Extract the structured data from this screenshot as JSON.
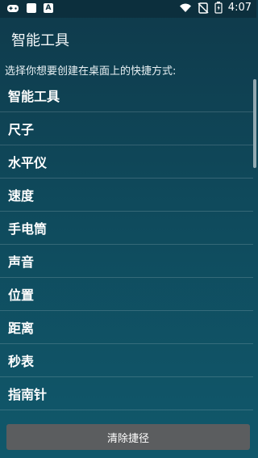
{
  "status_bar": {
    "time": "4:07",
    "left_icons": [
      "game-controller-icon",
      "square-icon",
      "a-box-icon"
    ],
    "a_box_label": "A",
    "right_icons": [
      "wifi-icon",
      "no-sim-icon",
      "battery-icon"
    ]
  },
  "app": {
    "title": "智能工具",
    "instruction": "选择你想要创建在桌面上的快捷方式:"
  },
  "shortcut_list": {
    "items": [
      {
        "label": "智能工具"
      },
      {
        "label": "尺子"
      },
      {
        "label": "水平仪"
      },
      {
        "label": "速度"
      },
      {
        "label": "手电筒"
      },
      {
        "label": "声音"
      },
      {
        "label": "位置"
      },
      {
        "label": "距离"
      },
      {
        "label": "秒表"
      },
      {
        "label": "指南针"
      }
    ]
  },
  "bottom": {
    "clear_button_label": "清除捷径"
  },
  "colors": {
    "background_top": "#0f3a4b",
    "background_bottom": "#10586b",
    "button_bg": "#5b5d5f",
    "text": "#ffffff"
  }
}
